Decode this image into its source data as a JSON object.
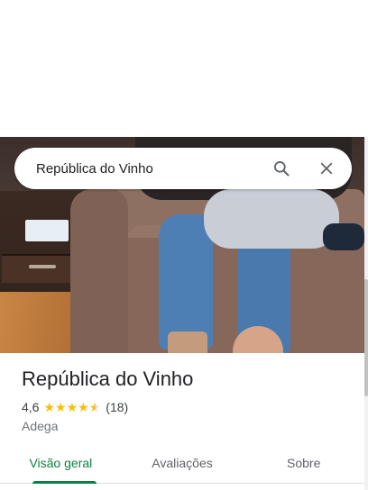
{
  "search": {
    "query": "República do Vinho"
  },
  "place": {
    "name": "República do Vinho",
    "rating": "4,6",
    "stars": 4.6,
    "review_count": "(18)",
    "category": "Adega"
  },
  "tabs": [
    {
      "label": "Visão geral",
      "active": true
    },
    {
      "label": "Avaliações",
      "active": false
    },
    {
      "label": "Sobre",
      "active": false
    }
  ],
  "colors": {
    "accent": "#0b8043",
    "star": "#fbbc04"
  },
  "icons": {
    "search": "search-icon",
    "close": "close-icon"
  }
}
